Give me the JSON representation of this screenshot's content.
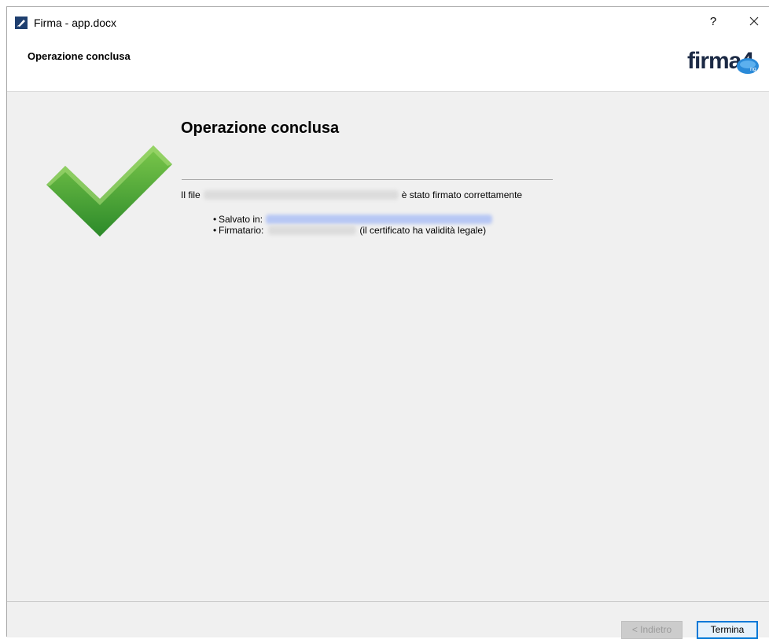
{
  "window": {
    "title": "Firma - app.docx",
    "help_label": "?",
    "close_label": "✕"
  },
  "header": {
    "title": "Operazione conclusa",
    "logo_text": "firma4",
    "logo_badge": "ng"
  },
  "content": {
    "title": "Operazione conclusa",
    "file_prefix": "Il file",
    "file_suffix": "è stato firmato correttamente",
    "saved_label": "Salvato in:",
    "signer_label": "Firmatario:",
    "signer_note": "(il certificato ha validità legale)",
    "bullet": "•"
  },
  "footer": {
    "back_label": "< Indietro",
    "finish_label": "Termina"
  },
  "colors": {
    "check_green": "#4aa638",
    "logo_navy": "#1c2a45",
    "logo_blue": "#2a8ad8"
  }
}
